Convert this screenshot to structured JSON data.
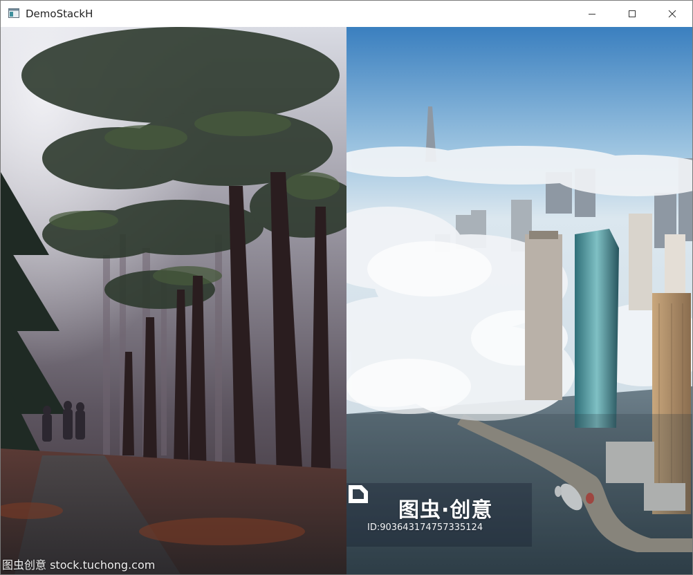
{
  "window": {
    "title": "DemoStackH"
  },
  "icons": {
    "app": "app-window-icon",
    "minimize": "minimize-icon",
    "maximize": "maximize-icon",
    "close": "close-icon"
  },
  "images": {
    "left": {
      "subject": "misty pine forest path",
      "watermark": "图虫创意 stock.tuchong.com"
    },
    "right": {
      "subject": "skyscrapers above clouds",
      "watermark_brand": "图虫·创意",
      "watermark_id": "ID:903643174757335124"
    }
  },
  "colors": {
    "titlebar_bg": "#ffffff",
    "title_text": "#222222",
    "window_border": "#7a7a7a"
  }
}
